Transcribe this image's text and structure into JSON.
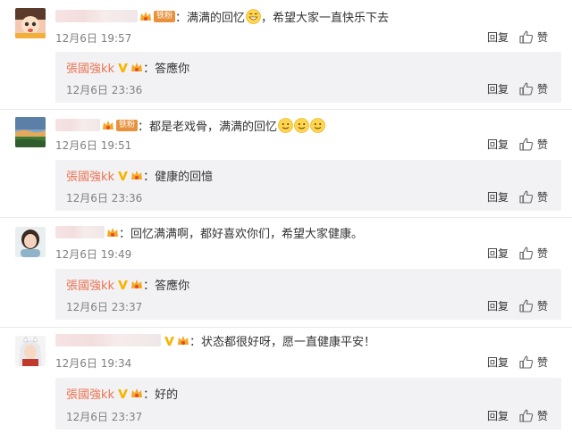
{
  "accent_color": "#eb7350",
  "labels": {
    "reply": "回复",
    "like": "赞",
    "badge_iron": "铁粉"
  },
  "comments": [
    {
      "avatar": "cartoon-boy-avatar",
      "text": "满满的回忆",
      "emoji_after": [
        "grin-sweat"
      ],
      "text2": "，希望大家一直快乐下去",
      "time": "12月6日 19:57",
      "reply": {
        "name": "張國強kk",
        "text": "答應你",
        "time": "12月6日 23:36"
      }
    },
    {
      "avatar": "landscape-avatar",
      "text": "都是老戏骨，满满的回忆",
      "emoji_after": [
        "smile",
        "smile",
        "smile"
      ],
      "time": "12月6日 19:51",
      "reply": {
        "name": "張國強kk",
        "text": "健康的回憶",
        "time": "12月6日 23:36"
      }
    },
    {
      "avatar": "woman-photo-avatar",
      "text": "回忆满满啊，都好喜欢你们，希望大家健康。",
      "time": "12月6日 19:49",
      "reply": {
        "name": "張國強kk",
        "text": "答應你",
        "time": "12月6日 23:37"
      }
    },
    {
      "avatar": "anime-character-avatar",
      "text": "状态都很好呀，愿一直健康平安！",
      "time": "12月6日 19:34",
      "reply": {
        "name": "張國強kk",
        "text": "好的",
        "time": "12月6日 23:37"
      }
    }
  ]
}
